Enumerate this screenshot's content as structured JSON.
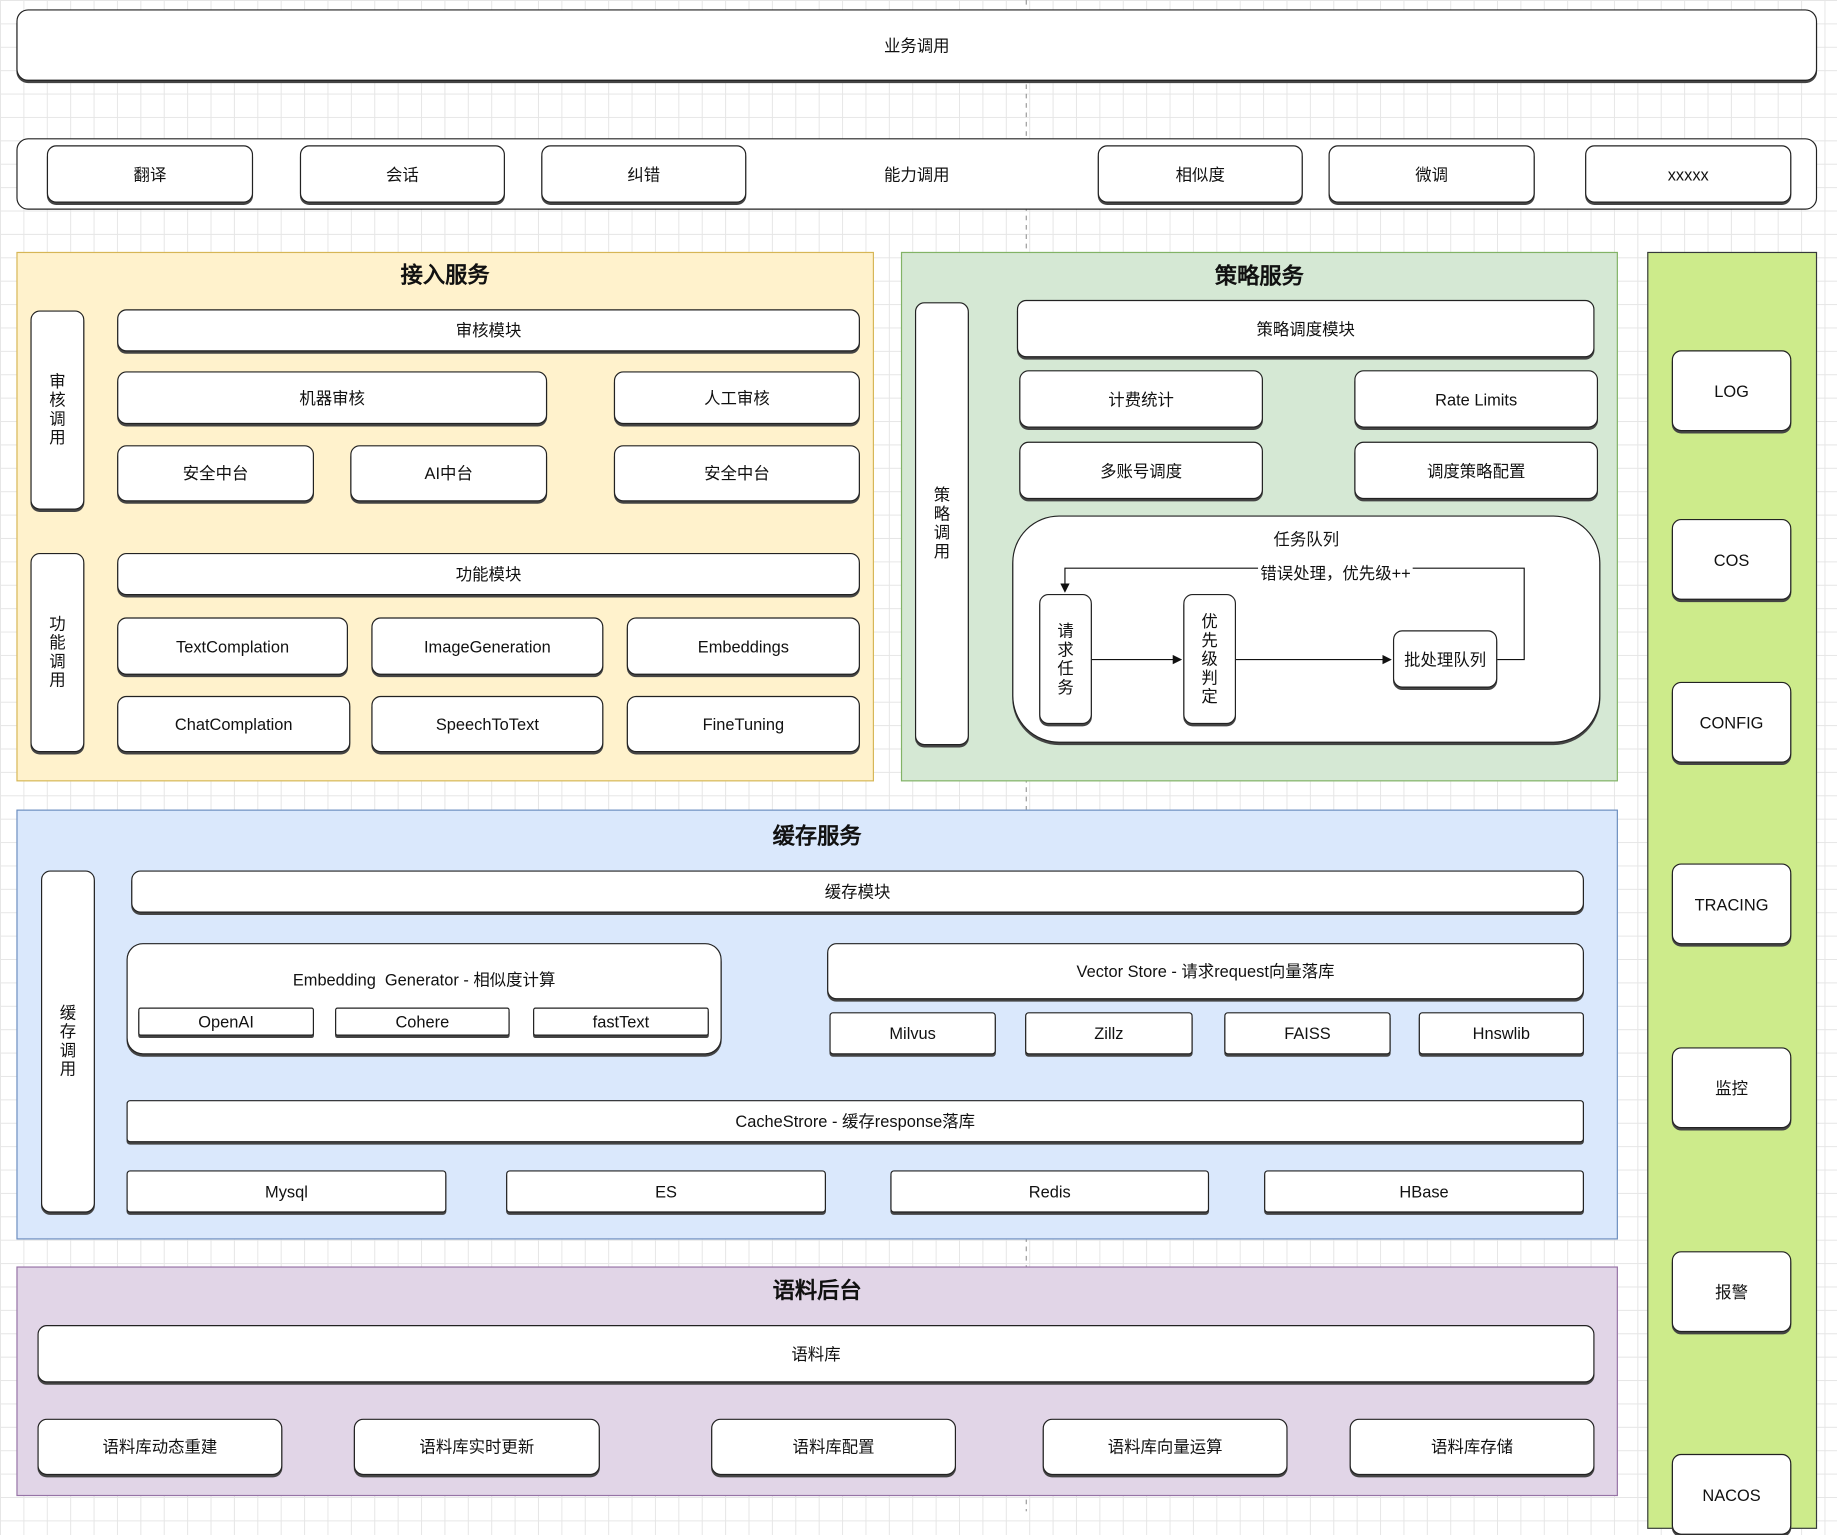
{
  "colors": {
    "access": "#fff2cc",
    "strategy": "#d5e8d4",
    "cache": "#dae8fc",
    "corpus": "#e1d5e7",
    "ops": "#cdeb8b"
  },
  "business": {
    "label": "业务调用"
  },
  "ability": {
    "label": "能力调用",
    "items": [
      "翻译",
      "会话",
      "纠错",
      "相似度",
      "微调",
      "xxxxx"
    ]
  },
  "access": {
    "title": "接入服务",
    "audit_call": "审核调用",
    "func_call": "功能调用",
    "audit_module": "审核模块",
    "machine_audit": "机器审核",
    "manual_audit": "人工审核",
    "sec1": "安全中台",
    "ai": "AI中台",
    "sec2": "安全中台",
    "func_module": "功能模块",
    "funcs": [
      "TextComplation",
      "ImageGeneration",
      "Embeddings",
      "ChatComplation",
      "SpeechToText",
      "FineTuning"
    ]
  },
  "strategy": {
    "title": "策略服务",
    "call": "策略调用",
    "dispatch_module": "策略调度模块",
    "billing": "计费统计",
    "rate_limits": "Rate Limits",
    "multi_account": "多账号调度",
    "dispatch_config": "调度策略配置",
    "queue": {
      "title": "任务队列",
      "request": "请求任务",
      "priority": "优先级判定",
      "batch": "批处理队列",
      "error": "错误处理，优先级++"
    }
  },
  "ops": {
    "items": [
      "LOG",
      "COS",
      "CONFIG",
      "TRACING",
      "监控",
      "报警",
      "NACOS"
    ]
  },
  "cache": {
    "title": "缓存服务",
    "call": "缓存调用",
    "module": "缓存模块",
    "embedding": "Embedding  Generator - 相似度计算",
    "embedders": [
      "OpenAI",
      "Cohere",
      "fastText"
    ],
    "vector_store": "Vector Store - 请求request向量落库",
    "vectors": [
      "Milvus",
      "Zillz",
      "FAISS",
      "Hnswlib"
    ],
    "cache_store": "CacheStrore - 缓存response落库",
    "stores": [
      "Mysql",
      "ES",
      "Redis",
      "HBase"
    ]
  },
  "corpus": {
    "title": "语料后台",
    "library": "语料库",
    "items": [
      "语料库动态重建",
      "语料库实时更新",
      "语料库配置",
      "语料库向量运算",
      "语料库存储"
    ]
  }
}
